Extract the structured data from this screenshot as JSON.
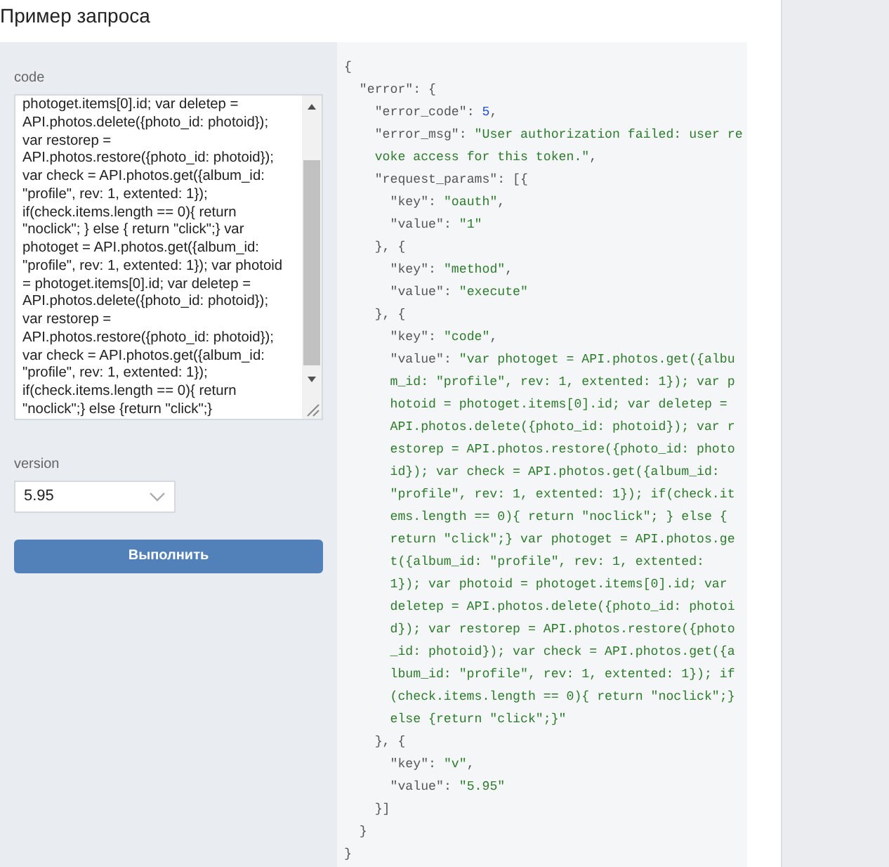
{
  "title": "Пример запроса",
  "form": {
    "code_label": "code",
    "code_value": "photoget.items[0].id; var deletep =\nAPI.photos.delete({photo_id: photoid});\nvar restorep =\nAPI.photos.restore({photo_id: photoid});\nvar check = API.photos.get({album_id:\n\"profile\", rev: 1, extented: 1});\nif(check.items.length == 0){ return\n\"noclick\"; } else { return \"click\";} var\nphotoget = API.photos.get({album_id:\n\"profile\", rev: 1, extented: 1}); var photoid\n= photoget.items[0].id; var deletep =\nAPI.photos.delete({photo_id: photoid});\nvar restorep =\nAPI.photos.restore({photo_id: photoid});\nvar check = API.photos.get({album_id:\n\"profile\", rev: 1, extented: 1});\nif(check.items.length == 0){ return\n\"noclick\";} else {return \"click\";}",
    "version_label": "version",
    "version_value": "5.95",
    "submit": "Выполнить"
  },
  "response": {
    "lines": [
      {
        "segs": [
          {
            "t": "{",
            "kind": "punct"
          }
        ]
      },
      {
        "segs": [
          {
            "t": "  \"error\": {",
            "kind": "punct"
          }
        ]
      },
      {
        "segs": [
          {
            "t": "    \"error_code\": ",
            "kind": "punct"
          },
          {
            "t": "5",
            "kind": "number"
          },
          {
            "t": ",",
            "kind": "punct"
          }
        ]
      },
      {
        "segs": [
          {
            "t": "    \"error_msg\": ",
            "kind": "punct"
          },
          {
            "t": "\"User authorization failed: user re",
            "kind": "string"
          }
        ]
      },
      {
        "wrap": true,
        "segs": [
          {
            "t": "voke access for this token.\"",
            "kind": "string"
          },
          {
            "t": ",",
            "kind": "punct"
          }
        ]
      },
      {
        "segs": [
          {
            "t": "    \"request_params\": [{",
            "kind": "punct"
          }
        ]
      },
      {
        "segs": [
          {
            "t": "      \"key\": ",
            "kind": "punct"
          },
          {
            "t": "\"oauth\"",
            "kind": "string"
          },
          {
            "t": ",",
            "kind": "punct"
          }
        ]
      },
      {
        "segs": [
          {
            "t": "      \"value\": ",
            "kind": "punct"
          },
          {
            "t": "\"1\"",
            "kind": "string"
          }
        ]
      },
      {
        "segs": [
          {
            "t": "    }, {",
            "kind": "punct"
          }
        ]
      },
      {
        "segs": [
          {
            "t": "      \"key\": ",
            "kind": "punct"
          },
          {
            "t": "\"method\"",
            "kind": "string"
          },
          {
            "t": ",",
            "kind": "punct"
          }
        ]
      },
      {
        "segs": [
          {
            "t": "      \"value\": ",
            "kind": "punct"
          },
          {
            "t": "\"execute\"",
            "kind": "string"
          }
        ]
      },
      {
        "segs": [
          {
            "t": "    }, {",
            "kind": "punct"
          }
        ]
      },
      {
        "segs": [
          {
            "t": "      \"key\": ",
            "kind": "punct"
          },
          {
            "t": "\"code\"",
            "kind": "string"
          },
          {
            "t": ",",
            "kind": "punct"
          }
        ]
      },
      {
        "segs": [
          {
            "t": "      \"value\": ",
            "kind": "punct"
          },
          {
            "t": "\"var photoget = API.photos.get({albu",
            "kind": "string"
          }
        ]
      },
      {
        "wrap": true,
        "segs": [
          {
            "t": "m_id: \"profile\", rev: 1, extented: 1}); var p",
            "kind": "string"
          }
        ]
      },
      {
        "wrap": true,
        "segs": [
          {
            "t": "hotoid = photoget.items[0].id; var deletep =",
            "kind": "string"
          }
        ]
      },
      {
        "wrap": true,
        "segs": [
          {
            "t": "API.photos.delete({photo_id: photoid}); var r",
            "kind": "string"
          }
        ]
      },
      {
        "wrap": true,
        "segs": [
          {
            "t": "estorep = API.photos.restore({photo_id: photo",
            "kind": "string"
          }
        ]
      },
      {
        "wrap": true,
        "segs": [
          {
            "t": "id}); var check = API.photos.get({album_id:",
            "kind": "string"
          }
        ]
      },
      {
        "wrap": true,
        "segs": [
          {
            "t": "\"profile\", rev: 1, extented: 1}); if(check.it",
            "kind": "string"
          }
        ]
      },
      {
        "wrap": true,
        "segs": [
          {
            "t": "ems.length == 0){ return \"noclick\"; } else {",
            "kind": "string"
          }
        ]
      },
      {
        "wrap": true,
        "segs": [
          {
            "t": "return \"click\";} var photoget = API.photos.ge",
            "kind": "string"
          }
        ]
      },
      {
        "wrap": true,
        "segs": [
          {
            "t": "t({album_id: \"profile\", rev: 1, extented:",
            "kind": "string"
          }
        ]
      },
      {
        "wrap": true,
        "segs": [
          {
            "t": "1}); var photoid = photoget.items[0].id; var",
            "kind": "string"
          }
        ]
      },
      {
        "wrap": true,
        "segs": [
          {
            "t": "deletep = API.photos.delete({photo_id: photoi",
            "kind": "string"
          }
        ]
      },
      {
        "wrap": true,
        "segs": [
          {
            "t": "d}); var restorep = API.photos.restore({photo",
            "kind": "string"
          }
        ]
      },
      {
        "wrap": true,
        "segs": [
          {
            "t": "_id: photoid}); var check = API.photos.get({a",
            "kind": "string"
          }
        ]
      },
      {
        "wrap": true,
        "segs": [
          {
            "t": "lbum_id: \"profile\", rev: 1, extented: 1}); if",
            "kind": "string"
          }
        ]
      },
      {
        "wrap": true,
        "segs": [
          {
            "t": "(check.items.length == 0){ return \"noclick\";}",
            "kind": "string"
          }
        ]
      },
      {
        "wrap": true,
        "segs": [
          {
            "t": "else {return \"click\";}\"",
            "kind": "string"
          }
        ]
      },
      {
        "segs": [
          {
            "t": "    }, {",
            "kind": "punct"
          }
        ]
      },
      {
        "segs": [
          {
            "t": "      \"key\": ",
            "kind": "punct"
          },
          {
            "t": "\"v\"",
            "kind": "string"
          },
          {
            "t": ",",
            "kind": "punct"
          }
        ]
      },
      {
        "segs": [
          {
            "t": "      \"value\": ",
            "kind": "punct"
          },
          {
            "t": "\"5.95\"",
            "kind": "string"
          }
        ]
      },
      {
        "segs": [
          {
            "t": "    }]",
            "kind": "punct"
          }
        ]
      },
      {
        "segs": [
          {
            "t": "  }",
            "kind": "punct"
          }
        ]
      },
      {
        "segs": [
          {
            "t": "}",
            "kind": "punct"
          }
        ]
      }
    ]
  }
}
